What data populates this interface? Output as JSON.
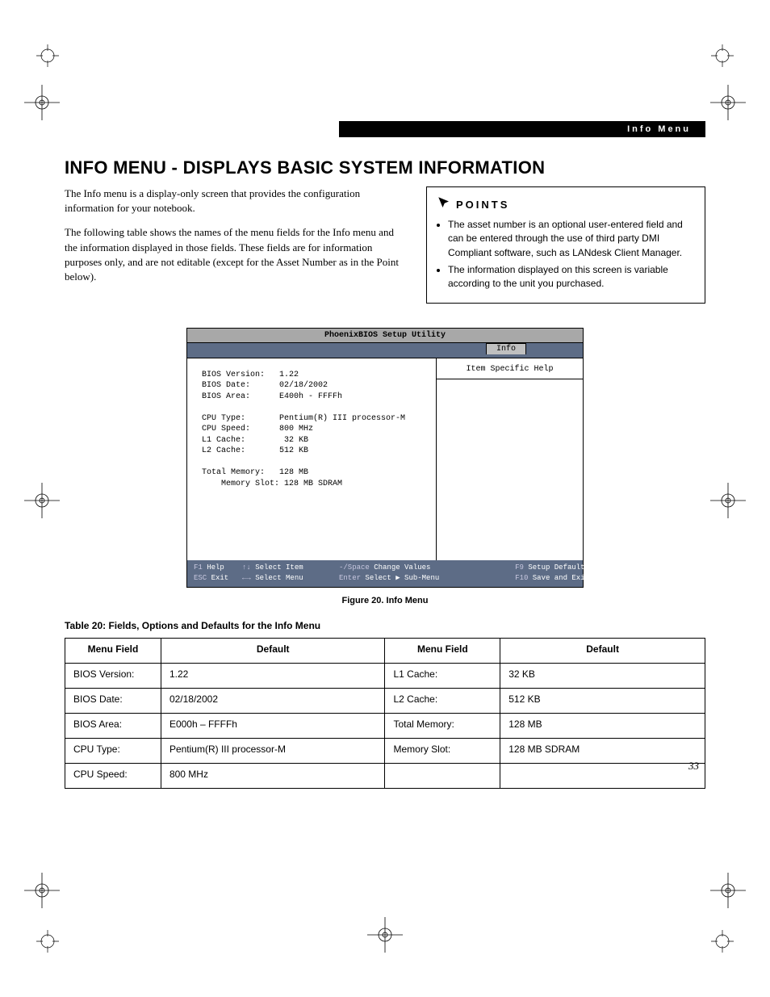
{
  "header": {
    "section": "Info Menu"
  },
  "title": "INFO MENU - DISPLAYS BASIC SYSTEM INFORMATION",
  "intro": {
    "p1": "The Info menu is a display-only screen that provides the configuration information for your notebook.",
    "p2": "The following table shows the names of the menu fields for the Info menu and the information displayed in those fields. These fields are for information purposes only, and are not editable (except for the Asset Number as in the Point below)."
  },
  "points": {
    "heading": "POINTS",
    "items": [
      "The asset number is an optional user-entered field and can be entered through the use of third party DMI Compliant software, such as LANdesk Client Manager.",
      "The information displayed on this screen is variable according to the unit you purchased."
    ]
  },
  "bios": {
    "title": "PhoenixBIOS Setup Utility",
    "tab": "Info",
    "help_title": "Item Specific Help",
    "content": "BIOS Version:   1.22\nBIOS Date:      02/18/2002\nBIOS Area:      E400h - FFFFh\n\nCPU Type:       Pentium(R) III processor-M\nCPU Speed:      800 MHz\nL1 Cache:        32 KB\nL2 Cache:       512 KB\n\nTotal Memory:   128 MB\n    Memory Slot: 128 MB SDRAM",
    "footer": {
      "f1": "F1",
      "f1_label": "Help",
      "ud": "↑↓",
      "ud_label": "Select Item",
      "ms": "-/Space",
      "ms_label": "Change Values",
      "f9": "F9",
      "f9_label": "Setup Defaults",
      "esc": "ESC",
      "esc_label": "Exit",
      "lr": "←→",
      "lr_label": "Select Menu",
      "enter": "Enter",
      "enter_label": "Select ▶ Sub-Menu",
      "f10": "F10",
      "f10_label": "Save and Exit"
    }
  },
  "figure_caption": "Figure 20.  Info Menu",
  "table_caption": "Table 20: Fields, Options and Defaults for the Info Menu",
  "table": {
    "h1": "Menu Field",
    "h2": "Default",
    "h3": "Menu Field",
    "h4": "Default",
    "rows": [
      {
        "c1": "BIOS Version:",
        "c2": "1.22",
        "c3": "L1 Cache:",
        "c4": "32 KB"
      },
      {
        "c1": "BIOS Date:",
        "c2": "02/18/2002",
        "c3": "L2 Cache:",
        "c4": "512 KB"
      },
      {
        "c1": "BIOS Area:",
        "c2": "E000h – FFFFh",
        "c3": "Total Memory:",
        "c4": "128 MB"
      },
      {
        "c1": "CPU Type:",
        "c2": "Pentium(R) III processor-M",
        "c3": "Memory Slot:",
        "c4": "128 MB SDRAM"
      },
      {
        "c1": "CPU Speed:",
        "c2": "800 MHz",
        "c3": "",
        "c4": ""
      }
    ]
  },
  "page_number": "33"
}
